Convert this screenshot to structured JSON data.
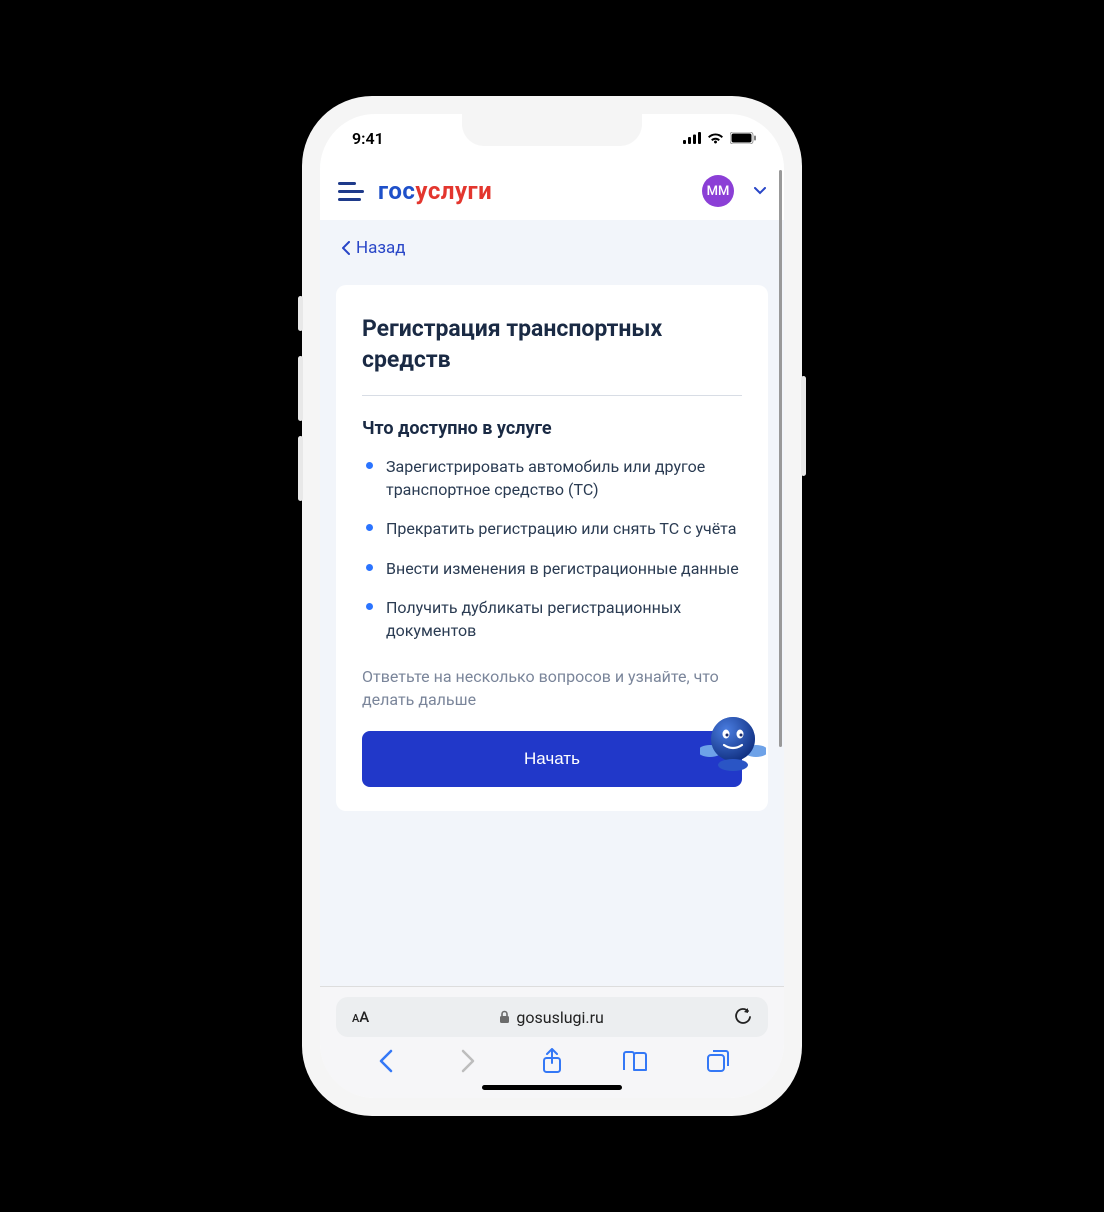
{
  "status": {
    "time": "9:41"
  },
  "header": {
    "logo_part1": "гос",
    "logo_part2": "услуги",
    "avatar_initials": "ММ"
  },
  "back": {
    "label": "Назад"
  },
  "card": {
    "title": "Регистрация транспортных средств",
    "subheading": "Что доступно в услуге",
    "bullets": [
      "Зарегистрировать автомобиль или другое транспортное средство (ТС)",
      "Прекратить регистрацию или снять ТС с учёта",
      "Внести изменения в регистрационные данные",
      "Получить дубликаты регистрационных документов"
    ],
    "hint": "Ответьте на несколько вопросов и узнайте, что делать дальше",
    "cta": "Начать"
  },
  "browser": {
    "url": "gosuslugi.ru"
  }
}
